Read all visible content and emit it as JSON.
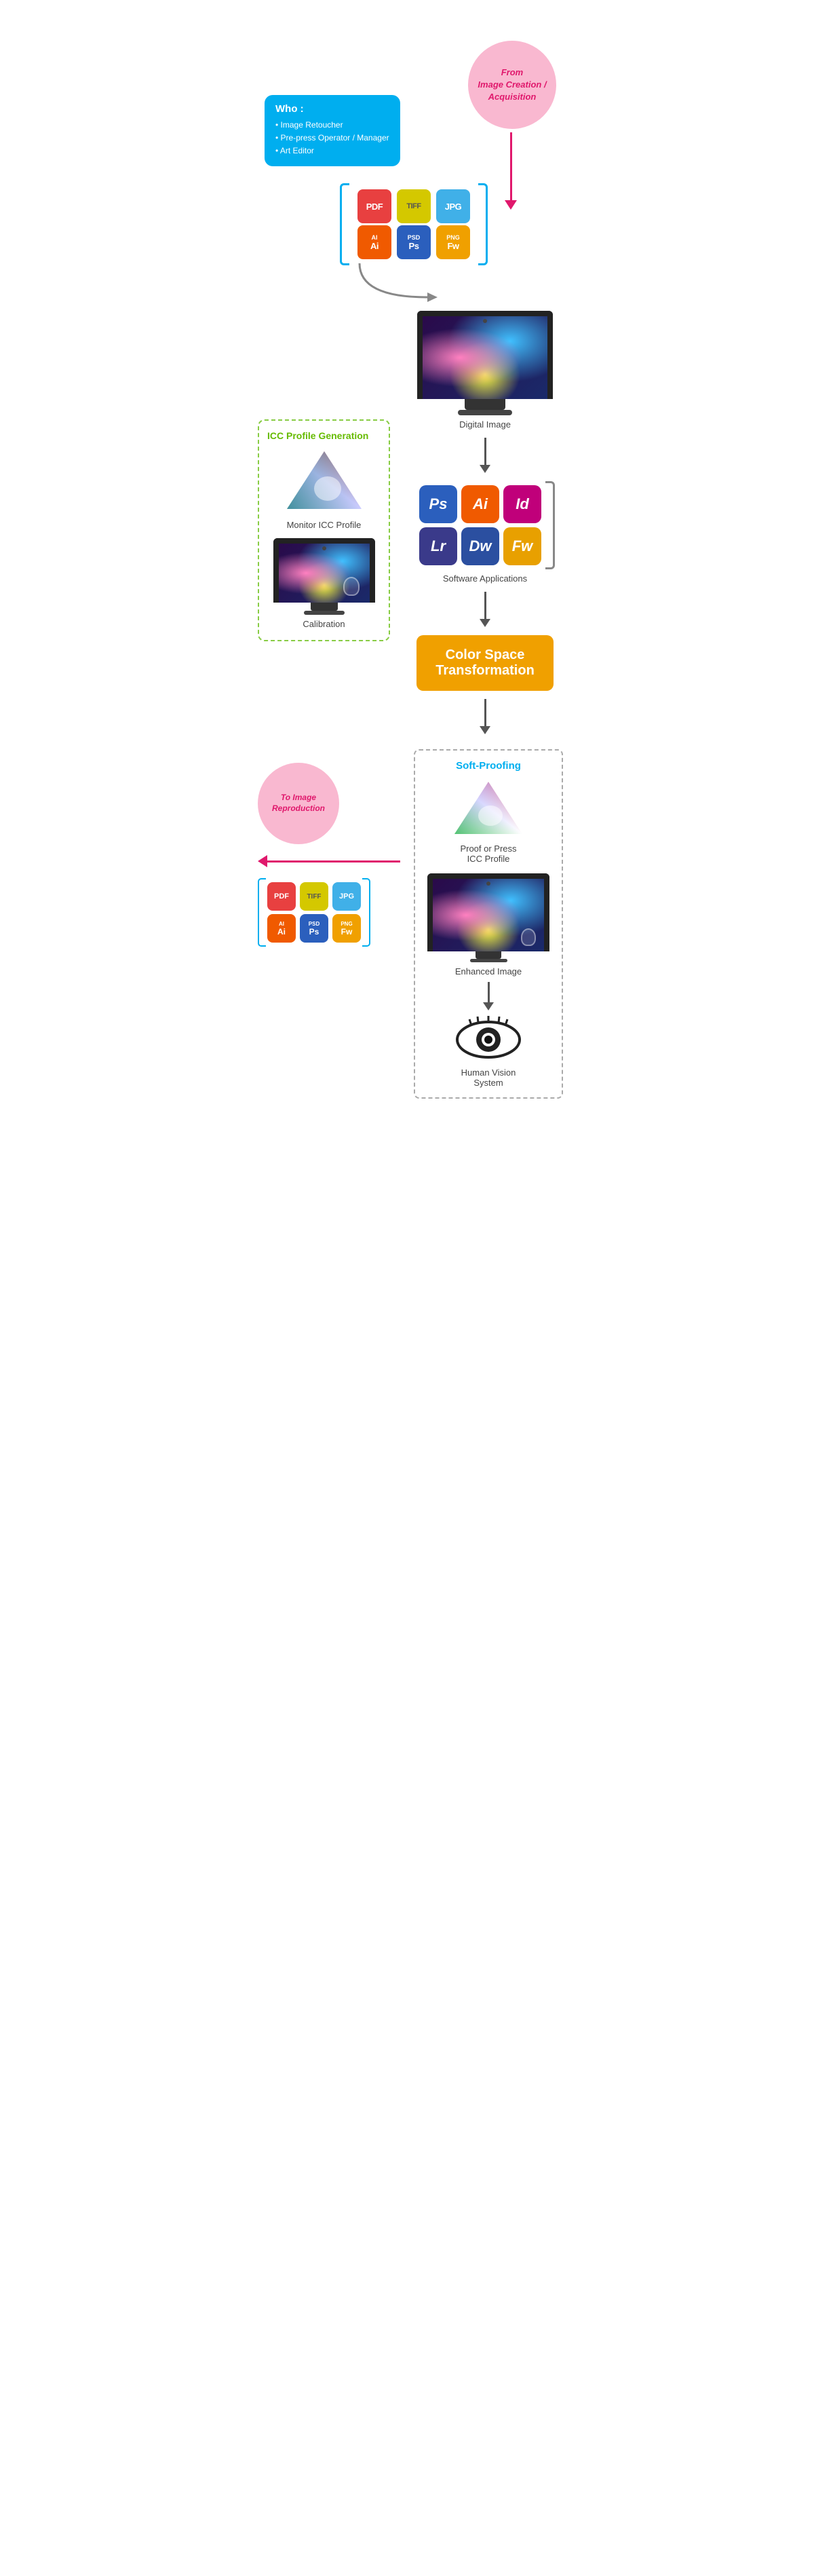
{
  "from_bubble": {
    "text": "From\nImage Creation /\nAcquisition"
  },
  "who_box": {
    "title": "Who :",
    "items": [
      "Image Retoucher",
      "Pre-press Operator / Manager",
      "Art Editor"
    ]
  },
  "file_icons_top": {
    "row1": [
      {
        "label": "PDF",
        "sub": "",
        "type": "pdf"
      },
      {
        "label": "TIFF",
        "sub": "",
        "type": "tiff"
      },
      {
        "label": "JPG",
        "sub": "",
        "type": "jpg"
      }
    ],
    "row2": [
      {
        "label": "Ai",
        "sub": "AI",
        "type": "ai"
      },
      {
        "label": "Ps",
        "sub": "PSD",
        "type": "psd"
      },
      {
        "label": "Fw",
        "sub": "PNG",
        "type": "png"
      }
    ]
  },
  "digital_image_label": "Digital Image",
  "icc_section": {
    "title": "ICC Profile Generation",
    "monitor_icc_label": "Monitor\nICC Profile",
    "calibration_label": "Calibration"
  },
  "software_apps_label": "Software Applications",
  "software_icons": [
    {
      "label": "Ps",
      "type": "ps"
    },
    {
      "label": "Ai",
      "type": "ai"
    },
    {
      "label": "Id",
      "type": "indd"
    },
    {
      "label": "Lr",
      "type": "lr"
    },
    {
      "label": "Dw",
      "type": "dw"
    },
    {
      "label": "Fw",
      "type": "fw"
    }
  ],
  "color_space": {
    "label": "Color Space\nTransformation"
  },
  "to_bubble": {
    "text": "To Image\nReproduction"
  },
  "file_icons_bottom": {
    "row1": [
      {
        "label": "PDF",
        "sub": "",
        "type": "pdf"
      },
      {
        "label": "TIFF",
        "sub": "",
        "type": "tiff"
      },
      {
        "label": "JPG",
        "sub": "",
        "type": "jpg"
      }
    ],
    "row2": [
      {
        "label": "Ai",
        "sub": "AI",
        "type": "ai"
      },
      {
        "label": "Ps",
        "sub": "PSD",
        "type": "psd"
      },
      {
        "label": "Fw",
        "sub": "PNG",
        "type": "png"
      }
    ]
  },
  "soft_proofing": {
    "title": "Soft-Proofing",
    "proof_label": "Proof or Press\nICC Profile",
    "enhanced_label": "Enhanced Image",
    "human_vision_label": "Human Vision\nSystem"
  }
}
